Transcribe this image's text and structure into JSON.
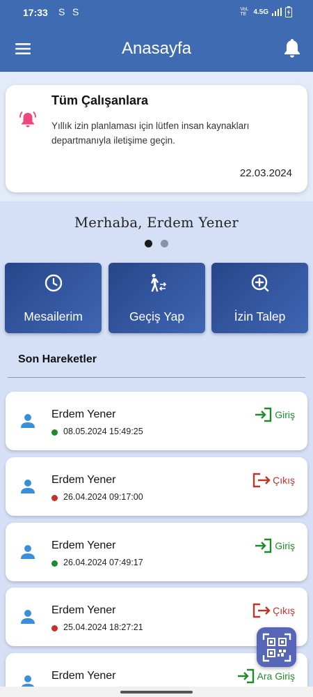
{
  "status_bar": {
    "time": "17:33",
    "notif_icons": [
      "S",
      "S"
    ],
    "network": "4.5G",
    "volte": "VoLTE"
  },
  "app_bar": {
    "title": "Anasayfa"
  },
  "announcement": {
    "title": "Tüm Çalışanlara",
    "body": "Yıllık izin planlaması için lütfen insan kaynakları departmanıyla iletişime geçin.",
    "date": "22.03.2024",
    "icon_color": "#f0457a"
  },
  "greeting": "Merhaba, Erdem Yener",
  "carousel": {
    "pages": 2,
    "active_index": 0
  },
  "actions": [
    {
      "label": "Mesailerim",
      "icon": "clock-icon"
    },
    {
      "label": "Geçiş Yap",
      "icon": "walk-transfer-icon"
    },
    {
      "label": "İzin Talep",
      "icon": "add-circle-icon"
    }
  ],
  "recent": {
    "title": "Son Hareketler",
    "items": [
      {
        "name": "Erdem Yener",
        "time": "08.05.2024 15:49:25",
        "type": "Giriş",
        "kind": "in"
      },
      {
        "name": "Erdem Yener",
        "time": "26.04.2024 09:17:00",
        "type": "Çıkış",
        "kind": "out"
      },
      {
        "name": "Erdem Yener",
        "time": "26.04.2024 07:49:17",
        "type": "Giriş",
        "kind": "in"
      },
      {
        "name": "Erdem Yener",
        "time": "25.04.2024 18:27:21",
        "type": "Çıkış",
        "kind": "out"
      },
      {
        "name": "Erdem Yener",
        "time": "",
        "type": "Ara Giriş",
        "kind": "in"
      }
    ]
  },
  "colors": {
    "primary": "#3f6bb2",
    "in": "#1f8a2a",
    "out": "#c1322a",
    "user_icon": "#3a8fdc",
    "qr_fab": "#5866b8"
  }
}
